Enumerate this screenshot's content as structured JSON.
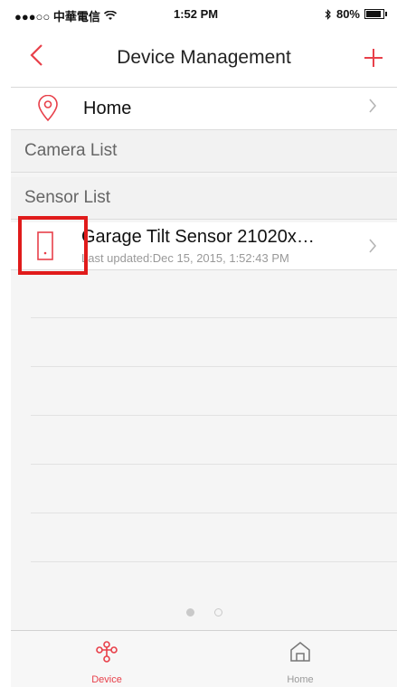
{
  "status_bar": {
    "carrier": "●●●○○ 中華電信",
    "wifi_icon": "wifi-icon",
    "time": "1:52 PM",
    "bluetooth_icon": "bluetooth-icon",
    "battery": "80%"
  },
  "navbar": {
    "back_icon": "chevron-left-icon",
    "title": "Device Management",
    "add_icon": "plus-icon"
  },
  "home_row": {
    "icon": "location-pin-icon",
    "label": "Home"
  },
  "sections": {
    "camera_list": "Camera List",
    "sensor_list": "Sensor List"
  },
  "sensors": [
    {
      "icon": "door-sensor-icon",
      "name": "Garage Tilt Sensor 21020x…",
      "updated": "Last updated:Dec 15, 2015, 1:52:43 PM"
    }
  ],
  "pager": {
    "pages": 2,
    "current": 1
  },
  "tabbar": {
    "tabs": [
      {
        "label": "Device",
        "icon": "device-network-icon",
        "active": true
      },
      {
        "label": "Home",
        "icon": "home-icon",
        "active": false
      }
    ]
  },
  "colors": {
    "accent": "#e8404a",
    "highlight": "#e01b1b"
  }
}
